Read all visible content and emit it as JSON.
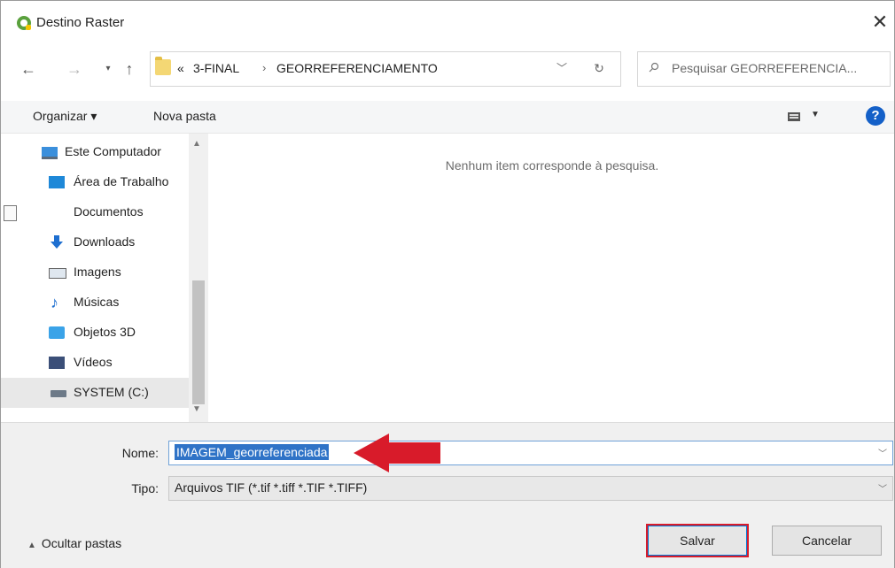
{
  "window": {
    "title": "Destino Raster"
  },
  "address": {
    "overflow": "«",
    "crumbs": [
      "3-FINAL",
      "GEORREFERENCIAMENTO"
    ],
    "separator": "›"
  },
  "search": {
    "placeholder": "Pesquisar GEORREFERENCIA..."
  },
  "toolbar": {
    "organize_label": "Organizar ▾",
    "new_folder_label": "Nova pasta",
    "help_label": "?"
  },
  "nav_tree": {
    "items": [
      {
        "label": "Este Computador",
        "icon": "computer-icon"
      },
      {
        "label": "Área de Trabalho",
        "icon": "desktop-icon"
      },
      {
        "label": "Documentos",
        "icon": "documents-icon"
      },
      {
        "label": "Downloads",
        "icon": "downloads-icon"
      },
      {
        "label": "Imagens",
        "icon": "pictures-icon"
      },
      {
        "label": "Músicas",
        "icon": "music-icon"
      },
      {
        "label": "Objetos 3D",
        "icon": "3d-objects-icon"
      },
      {
        "label": "Vídeos",
        "icon": "videos-icon"
      },
      {
        "label": "SYSTEM (C:)",
        "icon": "drive-icon",
        "selected": true
      }
    ]
  },
  "content": {
    "empty_message": "Nenhum item corresponde à pesquisa."
  },
  "form": {
    "name_label": "Nome:",
    "name_value": "IMAGEM_georreferenciada",
    "type_label": "Tipo:",
    "type_value": "Arquivos TIF (*.tif *.tiff *.TIF *.TIFF)"
  },
  "footer": {
    "hide_folders_label": "Ocultar pastas",
    "save_label": "Salvar",
    "cancel_label": "Cancelar"
  },
  "colors": {
    "accent": "#2f73c7",
    "annotation_red": "#d81b2a",
    "help_blue": "#1460c8"
  }
}
